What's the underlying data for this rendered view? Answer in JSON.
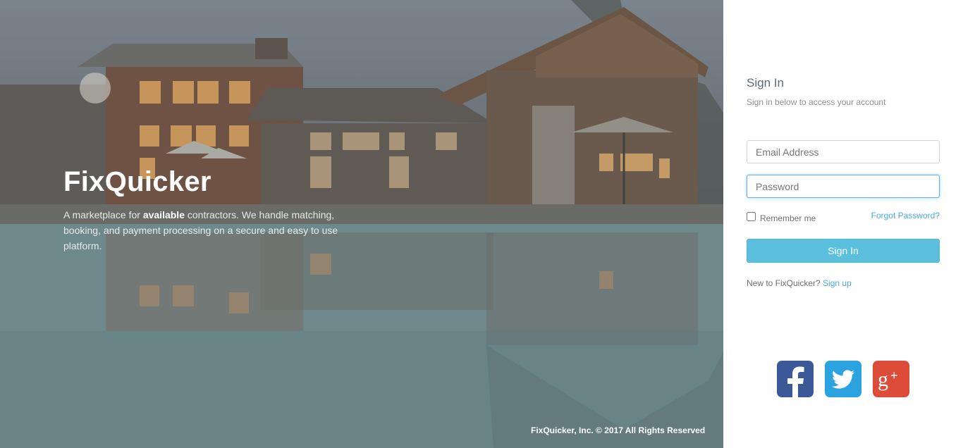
{
  "hero": {
    "brand": "FixQuicker",
    "tagline_pre": "A marketplace for ",
    "tagline_bold": "available",
    "tagline_post": " contractors. We handle matching, booking, and payment processing on a secure and easy to use platform.",
    "copyright": "FixQuicker, Inc. © 2017 All Rights Reserved"
  },
  "signin": {
    "title": "Sign In",
    "subtitle": "Sign in below to access your account",
    "email_placeholder": "Email Address",
    "password_placeholder": "Password",
    "remember_label": "Remember me",
    "forgot_label": "Forgot Password?",
    "button_label": "Sign In",
    "new_prefix": "New to FixQuicker?",
    "signup_label": "Sign up"
  },
  "social": [
    {
      "name": "facebook-icon",
      "color": "#3b5998"
    },
    {
      "name": "twitter-icon",
      "color": "#2aa3e0"
    },
    {
      "name": "google-plus-icon",
      "color": "#dd4b39"
    }
  ],
  "colors": {
    "accent": "#5bc0de",
    "link": "#4ba9dd"
  }
}
